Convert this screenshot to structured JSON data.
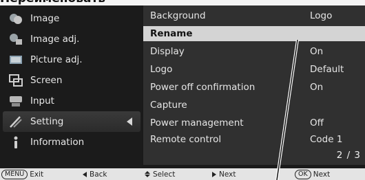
{
  "heading": "Переименовать",
  "side_menu": [
    {
      "label": "Image",
      "icon": "image-icon",
      "active": false
    },
    {
      "label": "Image adj.",
      "icon": "image-adj-icon",
      "active": false
    },
    {
      "label": "Picture adj.",
      "icon": "picture-adj-icon",
      "active": false
    },
    {
      "label": "Screen",
      "icon": "screen-icon",
      "active": false
    },
    {
      "label": "Input",
      "icon": "input-icon",
      "active": false
    },
    {
      "label": "Setting",
      "icon": "setting-icon",
      "active": true
    },
    {
      "label": "Information",
      "icon": "information-icon",
      "active": false
    }
  ],
  "rows": [
    {
      "label": "Background",
      "value": "Logo"
    },
    {
      "label": "Rename",
      "value": ""
    },
    {
      "label": "Display",
      "value": "On"
    },
    {
      "label": "Logo",
      "value": "Default"
    },
    {
      "label": "Power off confirmation",
      "value": "On"
    },
    {
      "label": "Capture",
      "value": ""
    },
    {
      "label": "Power management",
      "value": "Off"
    },
    {
      "label": "Remote control",
      "value": "Code 1"
    }
  ],
  "selected_row": "Rename",
  "pager": "2 / 3",
  "status": {
    "menu_key": "MENU",
    "exit": "Exit",
    "back": "Back",
    "select": "Select",
    "next": "Next",
    "ok_key": "OK",
    "ok_next": "Next"
  },
  "colors": {
    "menu_bg": "#1b1b1b",
    "panel_bg": "#303030",
    "selected_row_bg": "#d4d4d4",
    "status_bg": "#e4e4e4"
  }
}
